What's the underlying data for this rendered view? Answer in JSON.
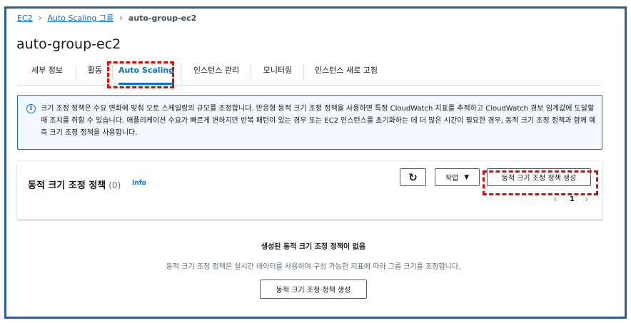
{
  "breadcrumb": {
    "items": [
      "EC2",
      "Auto Scaling 그룹"
    ],
    "current": "auto-group-ec2",
    "separator": "›"
  },
  "page": {
    "title": "auto-group-ec2"
  },
  "tabs": [
    {
      "label": "세부 정보",
      "active": false
    },
    {
      "label": "활동",
      "active": false
    },
    {
      "label": "Auto Scaling",
      "active": true
    },
    {
      "label": "인스턴스 관리",
      "active": false
    },
    {
      "label": "모니터링",
      "active": false
    },
    {
      "label": "인스턴스 새로 고침",
      "active": false
    }
  ],
  "info_box": {
    "icon": "info-circle-icon",
    "icon_glyph": "i",
    "text": "크기 조정 정책은 수요 변화에 맞춰 오토 스케일링의 규모를 조정합니다. 반응형 동적 크기 조정 정책을 사용하면 특정 CloudWatch 지표를 추적하고 CloudWatch 경보 임계값에 도달할 때 조치를 취할 수 있습니다. 애플리케이션 수요가 빠르게 변하지만 반복 패턴이 있는 경우 또는 EC2 인스턴스를 초기화하는 데 더 많은 시간이 필요한 경우, 동적 크기 조정 정책과 함께 예측 크기 조정 정책을 사용합니다."
  },
  "policy_panel": {
    "title": "동적 크기 조정 정책",
    "count": "(0)",
    "info_link": "Info",
    "refresh_icon": "refresh-icon",
    "refresh_glyph": "↻",
    "action_label": "작업",
    "action_caret": "▼",
    "create_label": "동적 크기 조정 정책 생성",
    "pager": {
      "prev": "‹",
      "page": "1",
      "next": "›"
    }
  },
  "empty_state": {
    "title": "생성된 동적 크기 조정 정책이 없음",
    "description": "동적 크기 조정 정책은 실시간 데이터를 사용하여 구성 가능한 지표에 따라 그룹 크기를 조정합니다.",
    "button_label": "동적 크기 조정 정책 생성"
  },
  "colors": {
    "accent": "#0972d3",
    "highlight": "#d80b0b",
    "frame": "#2e5d8e",
    "info_bg": "#f2f8fd"
  }
}
